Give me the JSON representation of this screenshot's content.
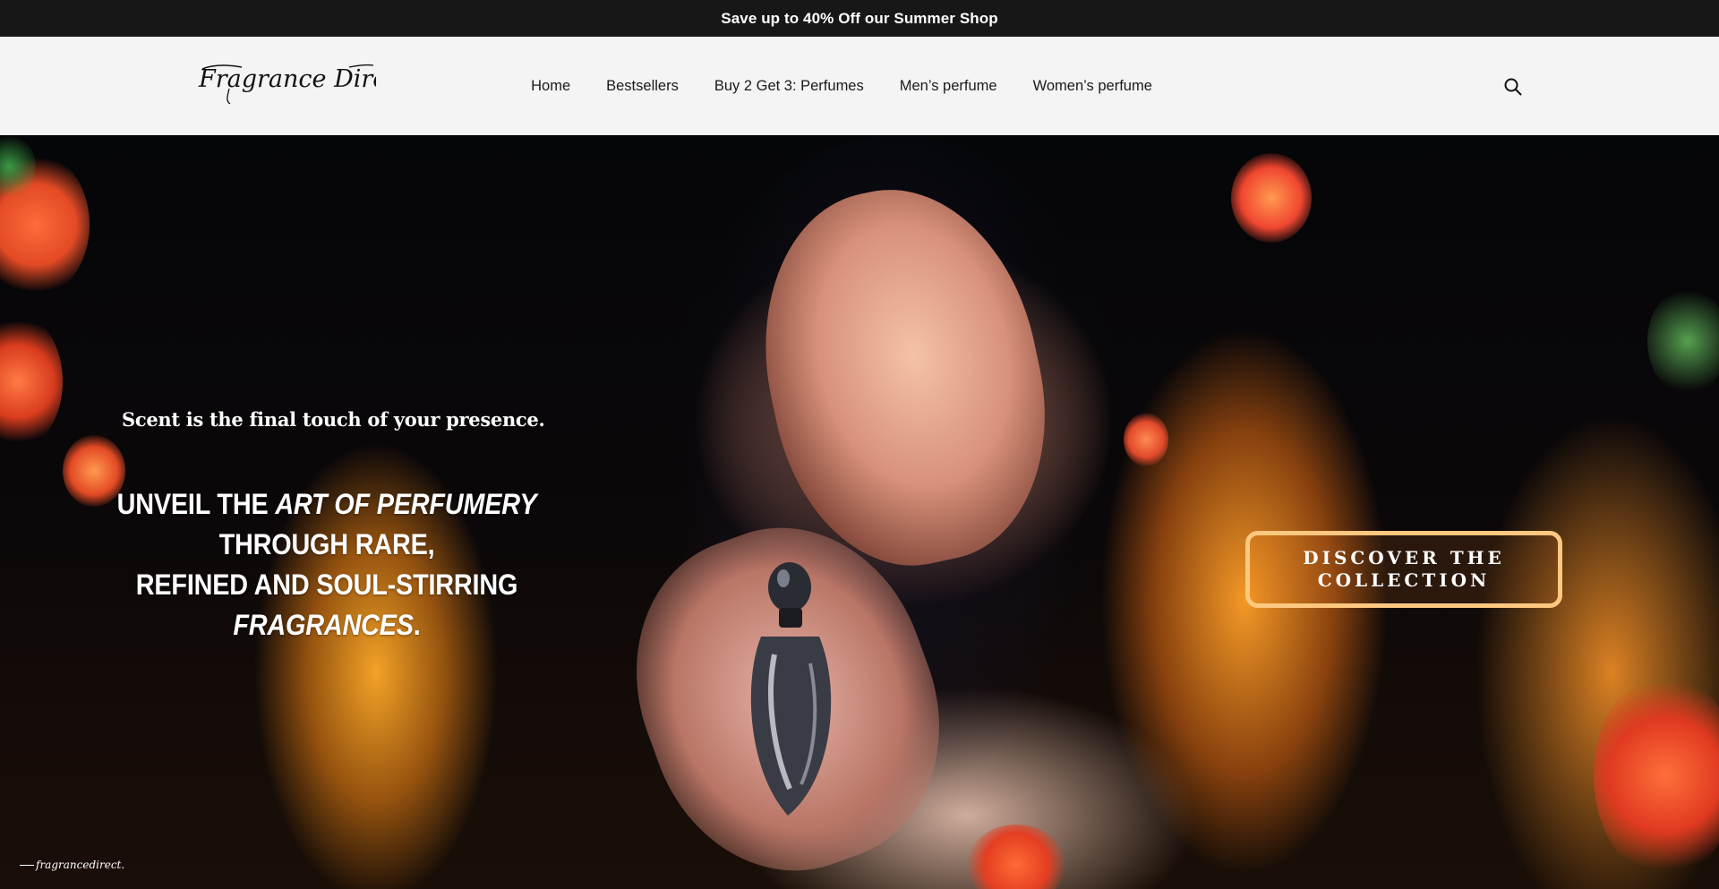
{
  "announcement": {
    "text": "Save up to 40% Off our Summer Shop"
  },
  "header": {
    "logo_text": "Fragrance Direct",
    "nav": [
      {
        "label": "Home"
      },
      {
        "label": "Bestsellers"
      },
      {
        "label": "Buy 2 Get 3: Perfumes"
      },
      {
        "label": "Men’s perfume"
      },
      {
        "label": "Women’s perfume"
      }
    ],
    "search_icon": "search-icon"
  },
  "hero": {
    "tagline": "Scent is the final touch of your presence.",
    "headline": {
      "line1_a": "UNVEIL THE ",
      "line1_em": "ART OF PERFUMERY",
      "line1_b": " THROUGH RARE,",
      "line2_a": "REFINED AND SOUL-STIRRING ",
      "line2_em": "FRAGRANCES",
      "line2_b": "."
    },
    "cta_line1": "DISCOVER THE",
    "cta_line2": "COLLECTION",
    "watermark": "fragrancedirect."
  },
  "colors": {
    "announcement_bg": "#171717",
    "header_bg": "#f4f4f4",
    "cta_border": "#ffc880",
    "glow": "#ffa52a"
  }
}
